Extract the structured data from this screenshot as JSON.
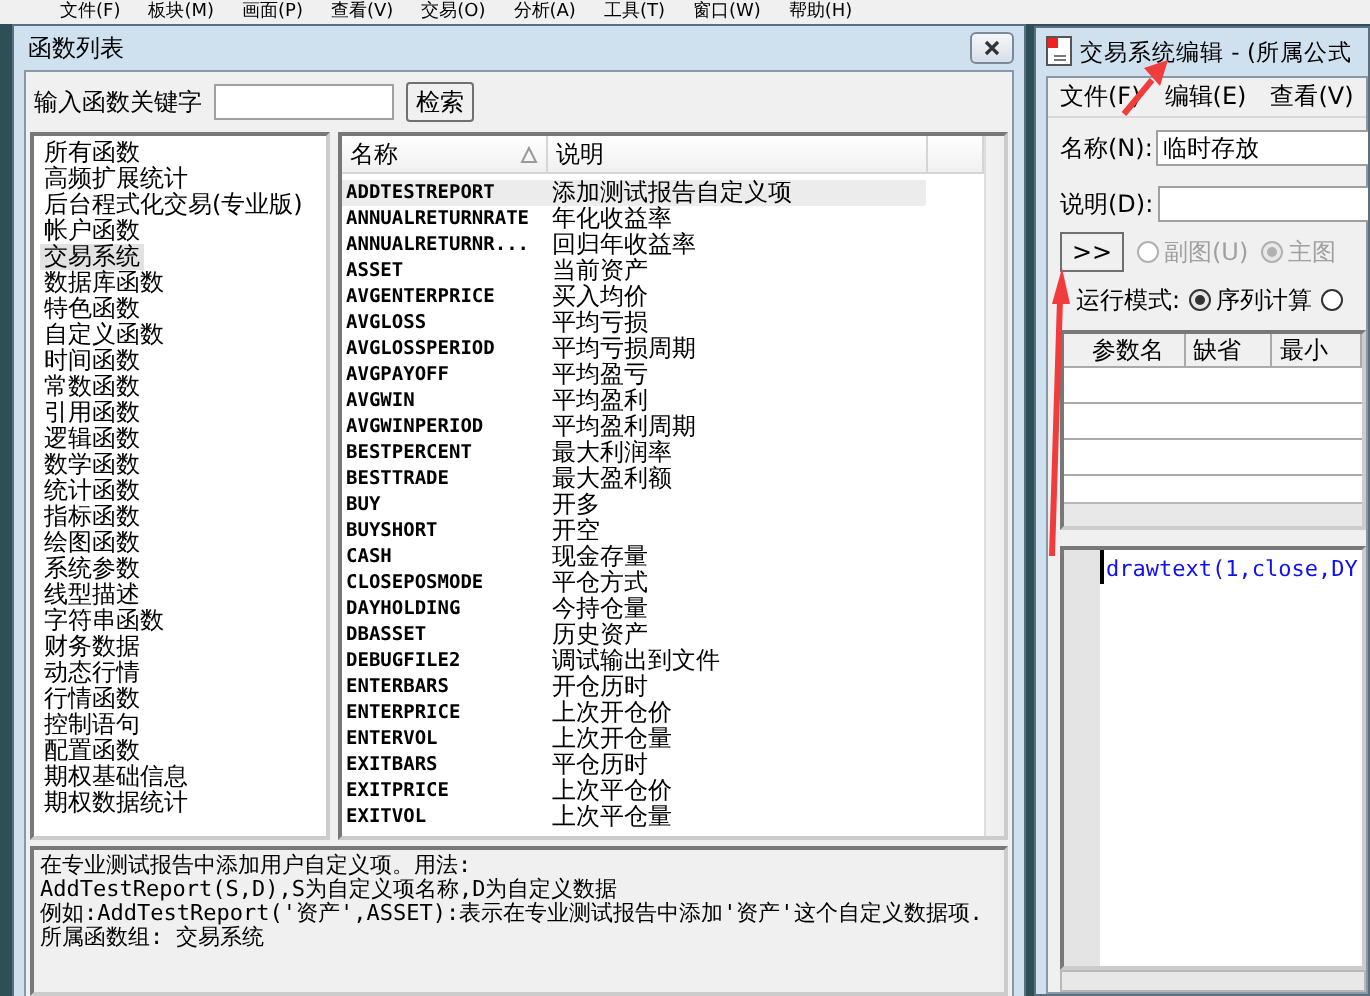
{
  "app_menu": [
    "文件(F)",
    "板块(M)",
    "画面(P)",
    "查看(V)",
    "交易(O)",
    "分析(A)",
    "工具(T)",
    "窗口(W)",
    "帮助(H)"
  ],
  "function_list_window": {
    "title": "函数列表",
    "search": {
      "label": "输入函数关键字",
      "button": "检索"
    },
    "categories": [
      {
        "label": "所有函数",
        "selected": false
      },
      {
        "label": "高频扩展统计",
        "selected": false
      },
      {
        "label": "后台程式化交易(专业版)",
        "selected": false
      },
      {
        "label": "帐户函数",
        "selected": false
      },
      {
        "label": "交易系统",
        "selected": true
      },
      {
        "label": "数据库函数",
        "selected": false
      },
      {
        "label": "特色函数",
        "selected": false
      },
      {
        "label": "自定义函数",
        "selected": false
      },
      {
        "label": "时间函数",
        "selected": false
      },
      {
        "label": "常数函数",
        "selected": false
      },
      {
        "label": "引用函数",
        "selected": false
      },
      {
        "label": "逻辑函数",
        "selected": false
      },
      {
        "label": "数学函数",
        "selected": false
      },
      {
        "label": "统计函数",
        "selected": false
      },
      {
        "label": "指标函数",
        "selected": false
      },
      {
        "label": "绘图函数",
        "selected": false
      },
      {
        "label": "系统参数",
        "selected": false
      },
      {
        "label": "线型描述",
        "selected": false
      },
      {
        "label": "字符串函数",
        "selected": false
      },
      {
        "label": "财务数据",
        "selected": false
      },
      {
        "label": "动态行情",
        "selected": false
      },
      {
        "label": "行情函数",
        "selected": false
      },
      {
        "label": "控制语句",
        "selected": false
      },
      {
        "label": "配置函数",
        "selected": false
      },
      {
        "label": "期权基础信息",
        "selected": false
      },
      {
        "label": "期权数据统计",
        "selected": false
      }
    ],
    "table": {
      "columns": [
        "名称",
        "说明"
      ],
      "rows": [
        {
          "name": "ADDTESTREPORT",
          "description": "添加测试报告自定义项",
          "selected": true
        },
        {
          "name": "ANNUALRETURNRATE",
          "description": "年化收益率",
          "selected": false
        },
        {
          "name": "ANNUALRETURNR...",
          "description": "回归年收益率",
          "selected": false
        },
        {
          "name": "ASSET",
          "description": "当前资产",
          "selected": false
        },
        {
          "name": "AVGENTERPRICE",
          "description": "买入均价",
          "selected": false
        },
        {
          "name": "AVGLOSS",
          "description": "平均亏损",
          "selected": false
        },
        {
          "name": "AVGLOSSPERIOD",
          "description": "平均亏损周期",
          "selected": false
        },
        {
          "name": "AVGPAYOFF",
          "description": "平均盈亏",
          "selected": false
        },
        {
          "name": "AVGWIN",
          "description": "平均盈利",
          "selected": false
        },
        {
          "name": "AVGWINPERIOD",
          "description": "平均盈利周期",
          "selected": false
        },
        {
          "name": "BESTPERCENT",
          "description": "最大利润率",
          "selected": false
        },
        {
          "name": "BESTTRADE",
          "description": "最大盈利额",
          "selected": false
        },
        {
          "name": "BUY",
          "description": "开多",
          "selected": false
        },
        {
          "name": "BUYSHORT",
          "description": "开空",
          "selected": false
        },
        {
          "name": "CASH",
          "description": "现金存量",
          "selected": false
        },
        {
          "name": "CLOSEPOSMODE",
          "description": "平仓方式",
          "selected": false
        },
        {
          "name": "DAYHOLDING",
          "description": "今持仓量",
          "selected": false
        },
        {
          "name": "DBASSET",
          "description": "历史资产",
          "selected": false
        },
        {
          "name": "DEBUGFILE2",
          "description": "调试输出到文件",
          "selected": false
        },
        {
          "name": "ENTERBARS",
          "description": "开仓历时",
          "selected": false
        },
        {
          "name": "ENTERPRICE",
          "description": "上次开仓价",
          "selected": false
        },
        {
          "name": "ENTERVOL",
          "description": "上次开仓量",
          "selected": false
        },
        {
          "name": "EXITBARS",
          "description": "平仓历时",
          "selected": false
        },
        {
          "name": "EXITPRICE",
          "description": "上次平仓价",
          "selected": false
        },
        {
          "name": "EXITVOL",
          "description": "上次平仓量",
          "selected": false
        }
      ]
    },
    "detail": [
      "在专业测试报告中添加用户自定义项。用法:",
      "AddTestReport(S,D),S为自定义项名称,D为自定义数据",
      "例如:AddTestReport('资产',ASSET):表示在专业测试报告中添加'资产'这个自定义数据项.",
      "所属函数组: 交易系统"
    ]
  },
  "editor_window": {
    "title": "交易系统编辑 - (所属公式",
    "menu": [
      "文件(F)",
      "编辑(E)",
      "查看(V)"
    ],
    "name_field": {
      "label": "名称(N):",
      "value": "临时存放"
    },
    "description_field": {
      "label": "说明(D):"
    },
    "expand_button": ">>",
    "chart_options": [
      {
        "label": "副图(U)",
        "selected": false
      },
      {
        "label": "主图",
        "selected": true
      }
    ],
    "run_mode": {
      "label": "运行模式:",
      "options": [
        {
          "label": "序列计算",
          "selected": true
        },
        {
          "selected": false
        }
      ]
    },
    "params_table": {
      "columns": [
        "参数名",
        "缺省",
        "最小"
      ]
    },
    "code": "drawtext(1,close,DY"
  }
}
